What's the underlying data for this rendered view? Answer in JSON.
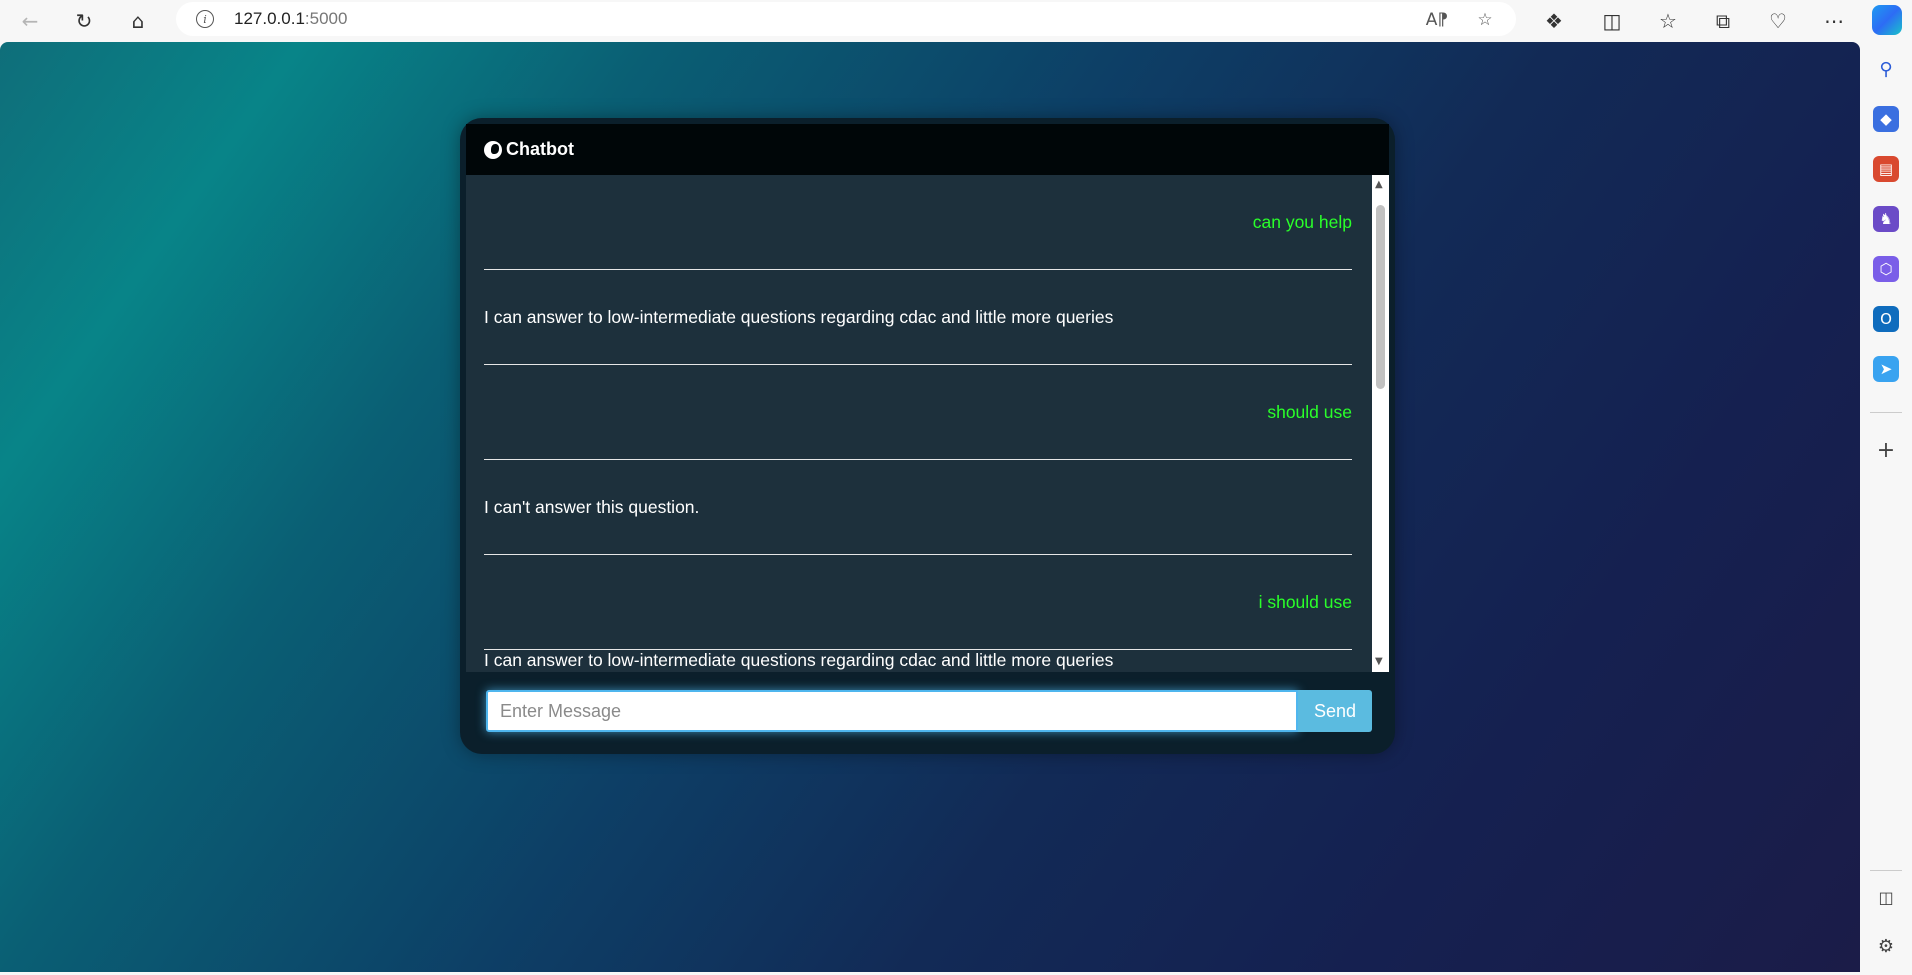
{
  "browser": {
    "url_host": "127.0.0.1",
    "url_port": ":5000"
  },
  "chat": {
    "title": "Chatbot",
    "messages": [
      {
        "role": "user",
        "text": "can you help"
      },
      {
        "role": "bot",
        "text": "I can answer to low-intermediate questions regarding cdac and little more queries"
      },
      {
        "role": "user",
        "text": "should use"
      },
      {
        "role": "bot",
        "text": "I can't answer this question."
      },
      {
        "role": "user",
        "text": "i should use"
      },
      {
        "role": "bot",
        "text": "I can answer to low-intermediate questions regarding cdac and little more queries"
      }
    ],
    "input_placeholder": "Enter Message",
    "send_label": "Send"
  },
  "icons": {
    "back": "back-arrow-icon",
    "refresh": "refresh-icon",
    "home": "home-icon",
    "info": "info-icon",
    "read_aloud": "read-aloud-icon",
    "favorite": "star-icon",
    "extensions": "puzzle-icon",
    "split_screen": "split-screen-icon",
    "favorites": "favorites-icon",
    "collections": "collections-icon",
    "health": "browser-essentials-icon",
    "more": "more-icon",
    "copilot": "copilot-icon"
  },
  "colors": {
    "user_text": "#2aff2a",
    "bot_text": "#ffffff",
    "send_button": "#5bbbe0",
    "header": "#000608",
    "messages_bg": "#1d303c"
  }
}
